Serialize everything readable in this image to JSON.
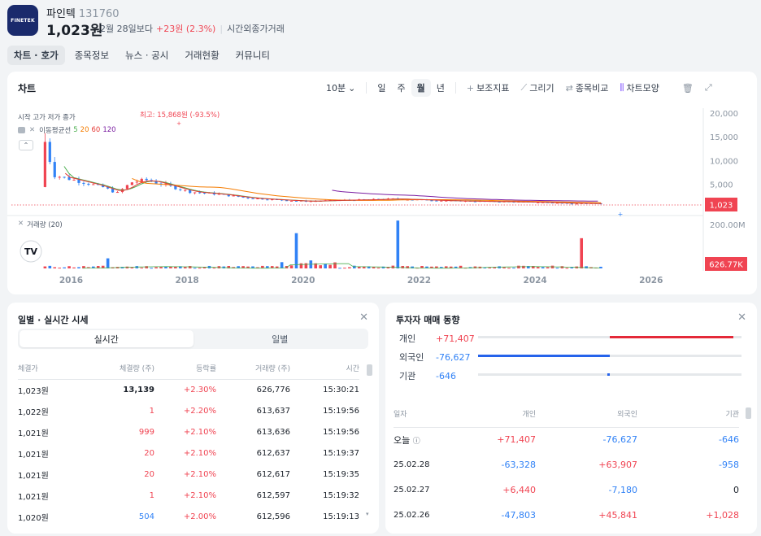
{
  "stock": {
    "logo_text": "FINETEK",
    "name": "파인텍",
    "code": "131760",
    "price": "1,023원",
    "compare_label": "2월 28일보다",
    "change": "+23원 (2.3%)",
    "session": "시간외종가거래"
  },
  "tabs": [
    {
      "label": "차트 · 호가",
      "active": true
    },
    {
      "label": "종목정보"
    },
    {
      "label": "뉴스 · 공시"
    },
    {
      "label": "거래현황"
    },
    {
      "label": "커뮤니티"
    }
  ],
  "chart": {
    "title": "차트",
    "period": "10분",
    "ranges": [
      "일",
      "주",
      "월",
      "년"
    ],
    "active_range": "월",
    "tools": {
      "indicator": "보조지표",
      "draw": "그리기",
      "compare": "종목비교",
      "shape": "차트모양"
    },
    "ohlc_label": "시작 고가 저가 종가",
    "ma_label": "이동평균선",
    "ma_periods": [
      "5",
      "20",
      "60",
      "120"
    ],
    "ma_colors": [
      "#4caf50",
      "#f57c00",
      "#e53935",
      "#7b1fa2"
    ],
    "high_label": "최고: 15,868원 (-93.5%)",
    "volume_label": "거래량 (20)",
    "price_ticks": [
      "20,000",
      "15,000",
      "10,000",
      "5,000"
    ],
    "current_price_tag": "1,023",
    "volume_tick": "200.00M",
    "volume_tag": "626.77K",
    "year_ticks": [
      "2016",
      "2018",
      "2020",
      "2022",
      "2024",
      "2026"
    ],
    "tv_logo": "TV"
  },
  "chart_data": {
    "type": "candlestick",
    "title": "",
    "x_axis": {
      "type": "date",
      "range": [
        2014.9,
        2026.9
      ],
      "ticks": [
        "2016",
        "2018",
        "2020",
        "2022",
        "2024",
        "2026"
      ]
    },
    "y_axis": {
      "unit": "원",
      "range": [
        0,
        20000
      ],
      "ticks": [
        5000,
        10000,
        15000,
        20000
      ]
    },
    "current_price": 1023,
    "all_time_high": 15868,
    "approx_monthly_close": [
      {
        "date": "2015-07",
        "close": 14000
      },
      {
        "date": "2015-09",
        "close": 7000
      },
      {
        "date": "2016-01",
        "close": 6000
      },
      {
        "date": "2016-07",
        "close": 4500
      },
      {
        "date": "2016-10",
        "close": 3200
      },
      {
        "date": "2017-01",
        "close": 5500
      },
      {
        "date": "2017-04",
        "close": 6000
      },
      {
        "date": "2017-07",
        "close": 5200
      },
      {
        "date": "2018-01",
        "close": 3500
      },
      {
        "date": "2018-07",
        "close": 3000
      },
      {
        "date": "2019-01",
        "close": 2200
      },
      {
        "date": "2019-07",
        "close": 1800
      },
      {
        "date": "2020-01",
        "close": 1500
      },
      {
        "date": "2020-07",
        "close": 1700
      },
      {
        "date": "2021-01",
        "close": 1800
      },
      {
        "date": "2021-07",
        "close": 2000
      },
      {
        "date": "2022-01",
        "close": 1800
      },
      {
        "date": "2022-07",
        "close": 1600
      },
      {
        "date": "2023-01",
        "close": 1500
      },
      {
        "date": "2023-07",
        "close": 1400
      },
      {
        "date": "2024-01",
        "close": 1300
      },
      {
        "date": "2024-07",
        "close": 1100
      },
      {
        "date": "2025-02",
        "close": 1023
      }
    ],
    "volume": {
      "unit": "shares",
      "range": [
        0,
        200000000
      ],
      "last": "626.77K",
      "spikes": [
        {
          "date": "2016-08",
          "value": 40000000
        },
        {
          "date": "2019-11",
          "value": 140000000
        },
        {
          "date": "2021-08",
          "value": 190000000
        },
        {
          "date": "2024-10",
          "value": 120000000
        }
      ]
    }
  },
  "trades": {
    "title": "일별 · 실시간 시세",
    "tabs": [
      "실시간",
      "일별"
    ],
    "active_tab": "실시간",
    "headers": [
      "체결가",
      "체결량 (주)",
      "등락률",
      "거래량 (주)",
      "시간"
    ],
    "rows": [
      {
        "price": "1,023원",
        "qty": "13,139",
        "rate": "+2.30%",
        "vol": "626,776",
        "time": "15:30:21",
        "qty_color": "black"
      },
      {
        "price": "1,022원",
        "qty": "1",
        "rate": "+2.20%",
        "vol": "613,637",
        "time": "15:19:56",
        "qty_color": "red"
      },
      {
        "price": "1,021원",
        "qty": "999",
        "rate": "+2.10%",
        "vol": "613,636",
        "time": "15:19:56",
        "qty_color": "red"
      },
      {
        "price": "1,021원",
        "qty": "20",
        "rate": "+2.10%",
        "vol": "612,637",
        "time": "15:19:37",
        "qty_color": "red"
      },
      {
        "price": "1,021원",
        "qty": "20",
        "rate": "+2.10%",
        "vol": "612,617",
        "time": "15:19:35",
        "qty_color": "red"
      },
      {
        "price": "1,021원",
        "qty": "1",
        "rate": "+2.10%",
        "vol": "612,597",
        "time": "15:19:32",
        "qty_color": "red"
      },
      {
        "price": "1,020원",
        "qty": "504",
        "rate": "+2.00%",
        "vol": "612,596",
        "time": "15:19:13",
        "qty_color": "blue"
      }
    ]
  },
  "investors": {
    "title": "투자자 매매 동향",
    "summary": [
      {
        "label": "개인",
        "value": "+71,407",
        "share": 0.47,
        "dir": "buy"
      },
      {
        "label": "외국인",
        "value": "-76,627",
        "share": 0.5,
        "dir": "sell"
      },
      {
        "label": "기관",
        "value": "-646",
        "share": 0.01,
        "dir": "sell"
      }
    ],
    "headers": [
      "일자",
      "개인",
      "외국인",
      "기관"
    ],
    "rows": [
      {
        "date": "오늘",
        "ind": "+71,407",
        "for": "-76,627",
        "inst": "-646"
      },
      {
        "date": "25.02.28",
        "ind": "-63,328",
        "for": "+63,907",
        "inst": "-958"
      },
      {
        "date": "25.02.27",
        "ind": "+6,440",
        "for": "-7,180",
        "inst": "0"
      },
      {
        "date": "25.02.26",
        "ind": "-47,803",
        "for": "+45,841",
        "inst": "+1,028"
      }
    ]
  }
}
